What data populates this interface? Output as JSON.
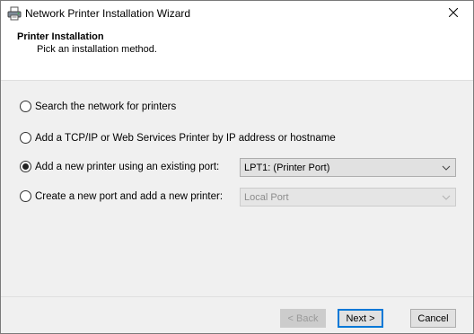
{
  "window": {
    "title": "Network Printer Installation Wizard",
    "icon": "printer-icon"
  },
  "header": {
    "title": "Printer Installation",
    "subtitle": "Pick an installation method."
  },
  "options": [
    {
      "label": "Search the network for printers",
      "selected": false
    },
    {
      "label": "Add a TCP/IP or Web Services Printer by IP address or hostname",
      "selected": false
    },
    {
      "label": "Add a new printer using an existing port:",
      "selected": true
    },
    {
      "label": "Create a new port and add a new printer:",
      "selected": false
    }
  ],
  "existing_port_select": {
    "value": "LPT1: (Printer Port)",
    "enabled": true
  },
  "new_port_select": {
    "value": "Local Port",
    "enabled": false
  },
  "buttons": {
    "back": "< Back",
    "next": "Next >",
    "cancel": "Cancel"
  },
  "colors": {
    "accent": "#0078d7",
    "dialog_bg": "#f0f0f0",
    "header_bg": "#ffffff"
  }
}
